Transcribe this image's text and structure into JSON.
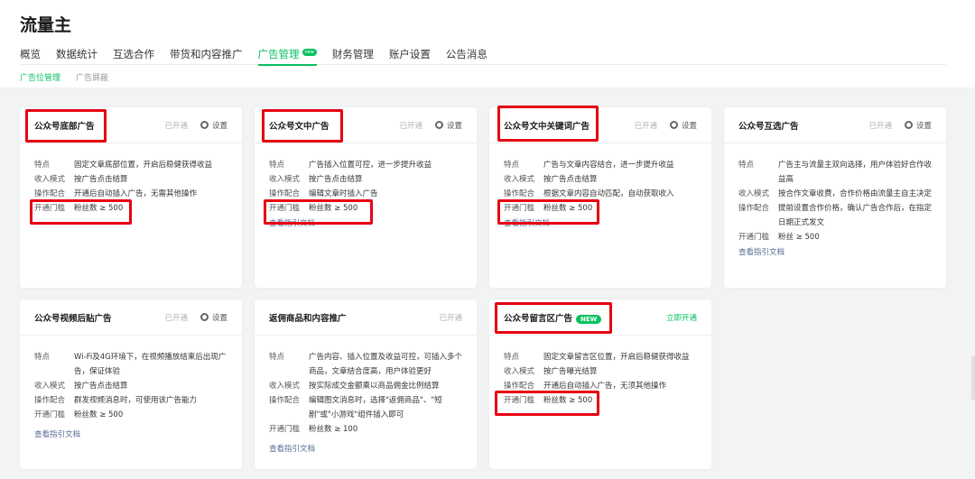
{
  "app_title": "流量主",
  "nav": [
    "概览",
    "数据统计",
    "互选合作",
    "带货和内容推广",
    "广告管理",
    "财务管理",
    "账户设置",
    "公告消息"
  ],
  "nav_badge": "new",
  "subnav": [
    "广告位管理",
    "广告屏蔽"
  ],
  "labels": {
    "settings": "设置",
    "guide": "查看指引文档"
  },
  "cards": [
    {
      "title": "公众号底部广告",
      "status": "已开通",
      "rows": [
        [
          "特点",
          "固定文章底部位置，开启后稳健获得收益"
        ],
        [
          "收入模式",
          "按广告点击结算"
        ],
        [
          "操作配合",
          "开通后自动插入广告，无需其他操作"
        ],
        [
          "开通门槛",
          "粉丝数 ≥ 500"
        ]
      ]
    },
    {
      "title": "公众号文中广告",
      "status": "已开通",
      "rows": [
        [
          "特点",
          "广告插入位置可控，进一步提升收益"
        ],
        [
          "收入模式",
          "按广告点击结算"
        ],
        [
          "操作配合",
          "编辑文章时插入广告"
        ],
        [
          "开通门槛",
          "粉丝数 ≥ 500"
        ]
      ]
    },
    {
      "title": "公众号文中关键词广告",
      "status": "已开通",
      "rows": [
        [
          "特点",
          "广告与文章内容结合，进一步提升收益"
        ],
        [
          "收入模式",
          "按广告点击结算"
        ],
        [
          "操作配合",
          "根据文章内容自动匹配，自动获取收入"
        ],
        [
          "开通门槛",
          "粉丝数 ≥ 500"
        ]
      ]
    },
    {
      "title": "公众号互选广告",
      "status": "已开通",
      "rows": [
        [
          "特点",
          "广告主与流量主双向选择，用户体验好合作收益高"
        ],
        [
          "收入模式",
          "按合作文章收费，合作价格由流量主自主决定"
        ],
        [
          "操作配合",
          "提前设置合作价格，确认广告合作后，在指定日期正式发文"
        ],
        [
          "开通门槛",
          "粉丝 ≥ 500"
        ]
      ]
    },
    {
      "title": "公众号视频后贴广告",
      "status": "已开通",
      "rows": [
        [
          "特点",
          "Wi-Fi及4G环境下，在视频播放结束后出现广告，保证体验"
        ],
        [
          "收入模式",
          "按广告点击结算"
        ],
        [
          "操作配合",
          "群发视频消息时，可使用该广告能力"
        ],
        [
          "开通门槛",
          "粉丝数 ≥ 500"
        ]
      ]
    },
    {
      "title": "返佣商品和内容推广",
      "status": "已开通",
      "rows": [
        [
          "特点",
          "广告内容、插入位置及收益可控，可插入多个商品，文章结合度高，用户体验更好"
        ],
        [
          "收入模式",
          "按实际成交金额乘以商品佣金比例结算"
        ],
        [
          "操作配合",
          "编辑图文消息时，选择\"返佣商品\"、\"短剧\"或\"小游戏\"组件插入即可"
        ],
        [
          "开通门槛",
          "粉丝数 ≥ 100"
        ]
      ]
    },
    {
      "title": "公众号留言区广告",
      "status": "立即开通",
      "badge": "NEW",
      "rows": [
        [
          "特点",
          "固定文章留言区位置，开启后稳健获得收益"
        ],
        [
          "收入模式",
          "按广告曝光结算"
        ],
        [
          "操作配合",
          "开通后自动插入广告，无须其他操作"
        ],
        [
          "开通门槛",
          "粉丝数 ≥ 500"
        ]
      ]
    }
  ],
  "colors": {
    "accent": "#07c160",
    "link": "#576b95",
    "highlight": "#e60012"
  }
}
